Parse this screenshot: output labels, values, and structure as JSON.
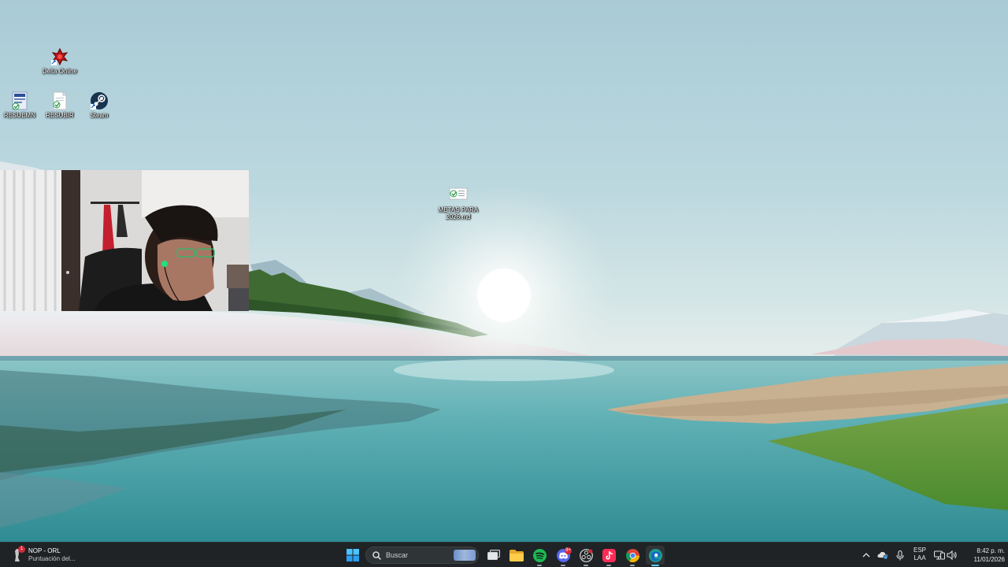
{
  "desktop": {
    "icons": [
      {
        "label": "Delta Online",
        "icon": "delta-online-game-icon"
      },
      {
        "label": "RESUEMN",
        "icon": "document-shortcut-icon"
      },
      {
        "label": "RESUBIR",
        "icon": "text-file-icon"
      },
      {
        "label": "Steam",
        "icon": "steam-icon"
      },
      {
        "label": "METAS PARA\n2026.md",
        "icon": "markdown-file-icon"
      }
    ]
  },
  "taskbar": {
    "weather": {
      "title": "NOP - ORL",
      "subtitle": "Puntuación del...",
      "icon": "sports-score-icon",
      "badge": "1"
    },
    "search_placeholder": "Buscar",
    "apps": [
      {
        "name": "start",
        "icon": "windows-start-icon"
      },
      {
        "name": "task-view",
        "icon": "task-view-icon"
      },
      {
        "name": "file-explorer",
        "icon": "folder-icon"
      },
      {
        "name": "spotify",
        "icon": "spotify-icon"
      },
      {
        "name": "discord",
        "icon": "discord-icon",
        "badge": "9+"
      },
      {
        "name": "obs-studio",
        "icon": "obs-icon"
      },
      {
        "name": "tiktok",
        "icon": "tiktok-icon"
      },
      {
        "name": "chrome",
        "icon": "chrome-icon"
      },
      {
        "name": "edge",
        "icon": "edge-icon"
      }
    ],
    "tray": {
      "language_line1": "ESP",
      "language_line2": "LAA",
      "time": "8:42 p. m.",
      "date": "11/01/2026"
    }
  },
  "colors": {
    "taskbar_bg": "#1f2325",
    "spotify_green": "#1db954",
    "discord_blurple": "#5865f2",
    "tiktok_pink": "#fe2c55",
    "edge_teal": "#1e9c8e"
  }
}
